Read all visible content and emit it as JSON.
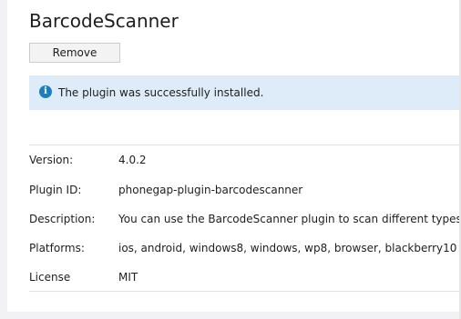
{
  "plugin": {
    "title": "BarcodeScanner",
    "remove_label": "Remove"
  },
  "notification": {
    "icon": "info-icon",
    "icon_glyph": "i",
    "message": "The plugin was successfully installed.",
    "color": "#1b7ec2",
    "background": "#ddecf8"
  },
  "details": {
    "version": {
      "label": "Version:",
      "value": "4.0.2"
    },
    "plugin_id": {
      "label": "Plugin ID:",
      "value": "phonegap-plugin-barcodescanner"
    },
    "description": {
      "label": "Description:",
      "value": "You can use the BarcodeScanner plugin to scan different types of barco"
    },
    "platforms": {
      "label": "Platforms:",
      "value": "ios, android, windows8, windows, wp8, browser, blackberry10"
    },
    "license": {
      "label": "License",
      "value": "MIT"
    }
  }
}
